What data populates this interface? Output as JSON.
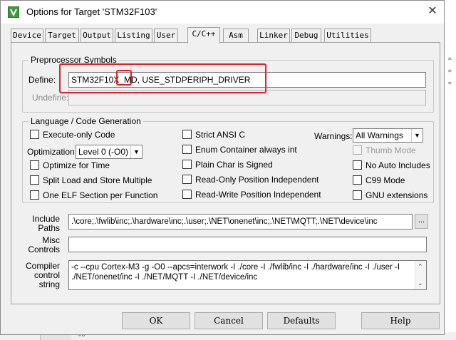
{
  "window": {
    "title": "Options for Target 'STM32F103'",
    "close_glyph": "✕",
    "icon": "keil-uvision-icon"
  },
  "tabs": [
    {
      "label": "Device"
    },
    {
      "label": "Target"
    },
    {
      "label": "Output"
    },
    {
      "label": "Listing"
    },
    {
      "label": "User"
    },
    {
      "label": "C/C++",
      "active": true
    },
    {
      "label": "Asm"
    },
    {
      "label": "Linker"
    },
    {
      "label": "Debug"
    },
    {
      "label": "Utilities"
    }
  ],
  "preprocessor": {
    "title": "Preprocessor Symbols",
    "define_label": "Define:",
    "define_value": "STM32F10X_MD, USE_STDPERIPH_DRIVER",
    "undefine_label": "Undefine:",
    "undefine_value": ""
  },
  "language": {
    "title": "Language / Code Generation",
    "execute_only": {
      "label": "Execute-only Code",
      "checked": false
    },
    "optimization_label": "Optimization:",
    "optimization_value": "Level 0 (-O0)",
    "optimize_time": {
      "label": "Optimize for Time",
      "checked": false
    },
    "split_load": {
      "label": "Split Load and Store Multiple",
      "checked": false
    },
    "one_elf": {
      "label": "One ELF Section per Function",
      "checked": false
    },
    "strict_ansi": {
      "label": "Strict ANSI C",
      "checked": false
    },
    "enum_container": {
      "label": "Enum Container always int",
      "checked": false
    },
    "plain_char": {
      "label": "Plain Char is Signed",
      "checked": false
    },
    "ropi": {
      "label": "Read-Only Position Independent",
      "checked": false
    },
    "rwpi": {
      "label": "Read-Write Position Independent",
      "checked": false
    },
    "warnings_label": "Warnings:",
    "warnings_value": "All Warnings",
    "thumb_mode": {
      "label": "Thumb Mode",
      "checked": false,
      "disabled": true
    },
    "no_auto_includes": {
      "label": "No Auto Includes",
      "checked": false
    },
    "c99_mode": {
      "label": "C99 Mode",
      "checked": false
    },
    "gnu_extensions": {
      "label": "GNU extensions",
      "checked": false
    }
  },
  "include_paths": {
    "label_line1": "Include",
    "label_line2": "Paths",
    "value": ".\\core;.\\fwlib\\inc;.\\hardware\\inc;.\\user;.\\NET\\onenet\\inc;.\\NET\\MQTT;.\\NET\\device\\inc",
    "browse_label": "..."
  },
  "misc_controls": {
    "label_line1": "Misc",
    "label_line2": "Controls",
    "value": ""
  },
  "compiler_string": {
    "label_line1": "Compiler",
    "label_line2": "control",
    "label_line3": "string",
    "line1": "-c --cpu Cortex-M3 -g -O0 --apcs=interwork -I ./core -I ./fwlib/inc -I ./hardware/inc -I ./user -I",
    "line2": "./NET/onenet/inc -I ./NET/MQTT -I ./NET/device/inc"
  },
  "buttons": {
    "ok": "OK",
    "cancel": "Cancel",
    "defaults": "Defaults",
    "help": "Help"
  },
  "background": {
    "line_number": "40"
  },
  "colors": {
    "highlight": "#e0202a",
    "dialog_bg": "#f0f0f0"
  }
}
